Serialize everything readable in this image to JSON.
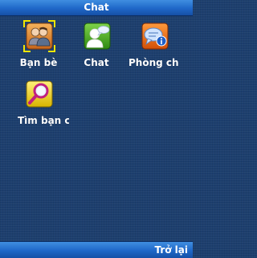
{
  "header": {
    "title": "Chat"
  },
  "grid": {
    "items": [
      {
        "label": "Bạn bè",
        "icon": "friends-icon",
        "selected": true
      },
      {
        "label": "Chat",
        "icon": "chat-person-icon",
        "selected": false
      },
      {
        "label": "Phòng ch",
        "icon": "chat-room-icon",
        "selected": false
      },
      {
        "label": "Tìm bạn c",
        "icon": "search-friend-icon",
        "selected": false
      }
    ]
  },
  "softkeys": {
    "right_label": "Trở lại"
  },
  "colors": {
    "background": "#1d3f6e",
    "bar": "#1f67c8",
    "selection": "#f2e600",
    "text": "#ffffff"
  }
}
